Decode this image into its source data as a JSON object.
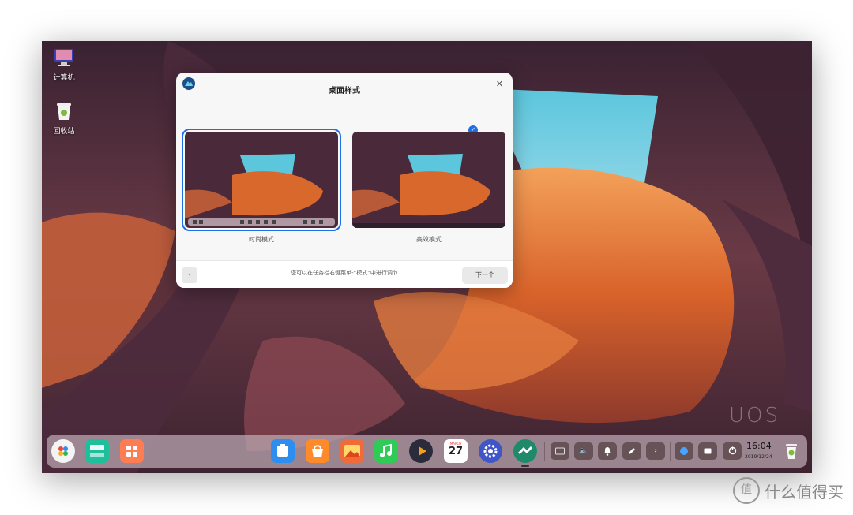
{
  "desktop": {
    "icons": [
      {
        "label": "计算机",
        "icon": "computer-icon"
      },
      {
        "label": "回收站",
        "icon": "trash-icon"
      }
    ],
    "watermark": "UOS"
  },
  "dialog": {
    "title": "桌面样式",
    "close_glyph": "✕",
    "options": [
      {
        "label": "时尚模式",
        "selected": true
      },
      {
        "label": "高效模式",
        "selected": false
      }
    ],
    "check_glyph": "✓",
    "prev_glyph": "‹",
    "hint": "您可以在任务栏右键菜单-“模式”中进行调节",
    "next_label": "下一个"
  },
  "dock": {
    "apps": [
      "launcher-icon",
      "multitask-icon",
      "control-center-icon",
      "file-manager-icon",
      "app-store-icon",
      "image-viewer-icon",
      "music-icon",
      "video-player-icon",
      "calendar-icon",
      "system-settings-icon",
      "browser-icon"
    ],
    "calendar": {
      "month": "MARCH",
      "day": "27"
    },
    "tray": [
      "keyboard-icon",
      "volume-icon",
      "notification-icon",
      "pen-icon",
      "chevron-right-icon",
      "network-icon",
      "screen-icon",
      "power-icon"
    ],
    "tray_glyphs": {
      "volume": "🔈",
      "chevron": "›"
    },
    "clock": {
      "time": "16:04",
      "date": "2019/12/24"
    }
  },
  "page_watermark": {
    "logo_glyph": "值",
    "text": "什么值得买"
  },
  "colors": {
    "accent": "#1c6fe6",
    "sky": "#4fb8d6",
    "rock_orange": "#e06a2a",
    "rock_purple": "#5a3450"
  }
}
